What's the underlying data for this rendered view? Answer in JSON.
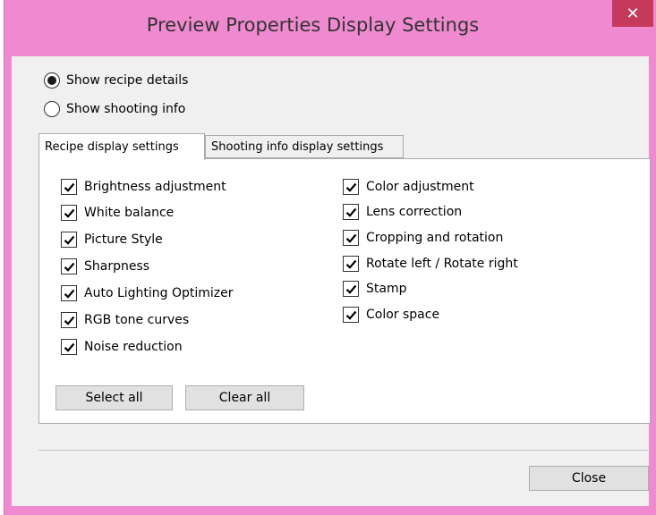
{
  "window": {
    "title": "Preview Properties Display Settings",
    "close_glyph": "✕",
    "colors": {
      "frame": "#f08ad0",
      "close_button": "#c7395b",
      "client": "#f0f0f0"
    }
  },
  "display_mode": {
    "options": [
      {
        "label": "Show recipe details",
        "selected": true
      },
      {
        "label": "Show shooting info",
        "selected": false
      }
    ]
  },
  "tabs": [
    {
      "label": "Recipe display settings",
      "active": true
    },
    {
      "label": "Shooting info display settings",
      "active": false
    }
  ],
  "recipe_settings": {
    "left_column": [
      {
        "label": "Brightness adjustment",
        "checked": true
      },
      {
        "label": "White balance",
        "checked": true
      },
      {
        "label": "Picture Style",
        "checked": true
      },
      {
        "label": "Sharpness",
        "checked": true
      },
      {
        "label": "Auto Lighting Optimizer",
        "checked": true
      },
      {
        "label": "RGB tone curves",
        "checked": true
      },
      {
        "label": "Noise reduction",
        "checked": true
      }
    ],
    "right_column": [
      {
        "label": "Color adjustment",
        "checked": true
      },
      {
        "label": "Lens correction",
        "checked": true
      },
      {
        "label": "Cropping and rotation",
        "checked": true
      },
      {
        "label": "Rotate left / Rotate right",
        "checked": true
      },
      {
        "label": "Stamp",
        "checked": true
      },
      {
        "label": "Color space",
        "checked": true
      }
    ],
    "select_all_label": "Select all",
    "clear_all_label": "Clear all"
  },
  "footer": {
    "close_label": "Close"
  }
}
